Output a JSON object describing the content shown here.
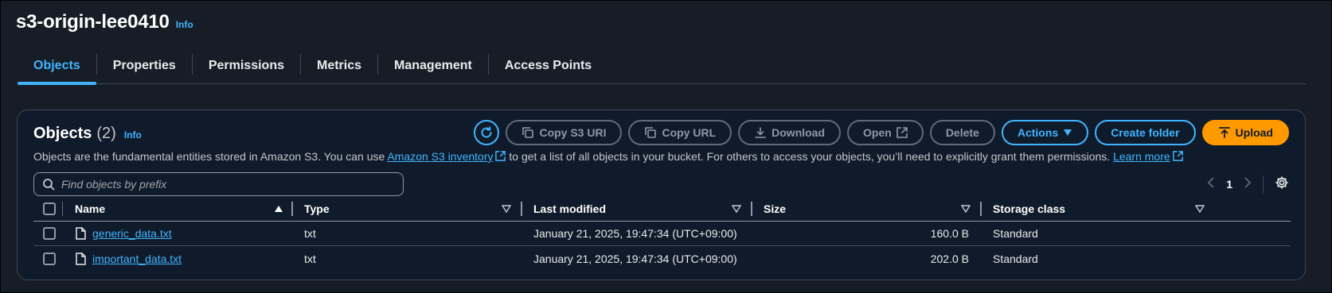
{
  "bucket": {
    "title": "s3-origin-lee0410",
    "info_label": "Info"
  },
  "tabs": [
    {
      "label": "Objects",
      "active": true
    },
    {
      "label": "Properties"
    },
    {
      "label": "Permissions"
    },
    {
      "label": "Metrics"
    },
    {
      "label": "Management"
    },
    {
      "label": "Access Points"
    }
  ],
  "objects_panel": {
    "title": "Objects",
    "count": "(2)",
    "info_label": "Info",
    "description_prefix": "Objects are the fundamental entities stored in Amazon S3. You can use",
    "inventory_link": "Amazon S3 inventory",
    "description_middle": "to get a list of all objects in your bucket. For others to access your objects, you’ll need to explicitly grant them permissions.",
    "learn_more_link": "Learn more"
  },
  "toolbar": {
    "refresh_icon": "refresh-icon",
    "copy_s3_uri": "Copy S3 URI",
    "copy_url": "Copy URL",
    "download": "Download",
    "open": "Open",
    "delete": "Delete",
    "actions": "Actions",
    "create_folder": "Create folder",
    "upload": "Upload"
  },
  "search": {
    "placeholder": "Find objects by prefix",
    "value": ""
  },
  "pagination": {
    "current_page": "1"
  },
  "table": {
    "columns": [
      "Name",
      "Type",
      "Last modified",
      "Size",
      "Storage class"
    ],
    "rows": [
      {
        "name": "generic_data.txt",
        "type": "txt",
        "last_modified": "January 21, 2025, 19:47:34 (UTC+09:00)",
        "size": "160.0 B",
        "storage_class": "Standard"
      },
      {
        "name": "important_data.txt",
        "type": "txt",
        "last_modified": "January 21, 2025, 19:47:34 (UTC+09:00)",
        "size": "202.0 B",
        "storage_class": "Standard"
      }
    ]
  },
  "colors": {
    "background": "#161d26",
    "panel": "#0f1b2a",
    "accent": "#42b4ff",
    "primary_button": "#ff9900",
    "disabled": "#8d99a8"
  }
}
